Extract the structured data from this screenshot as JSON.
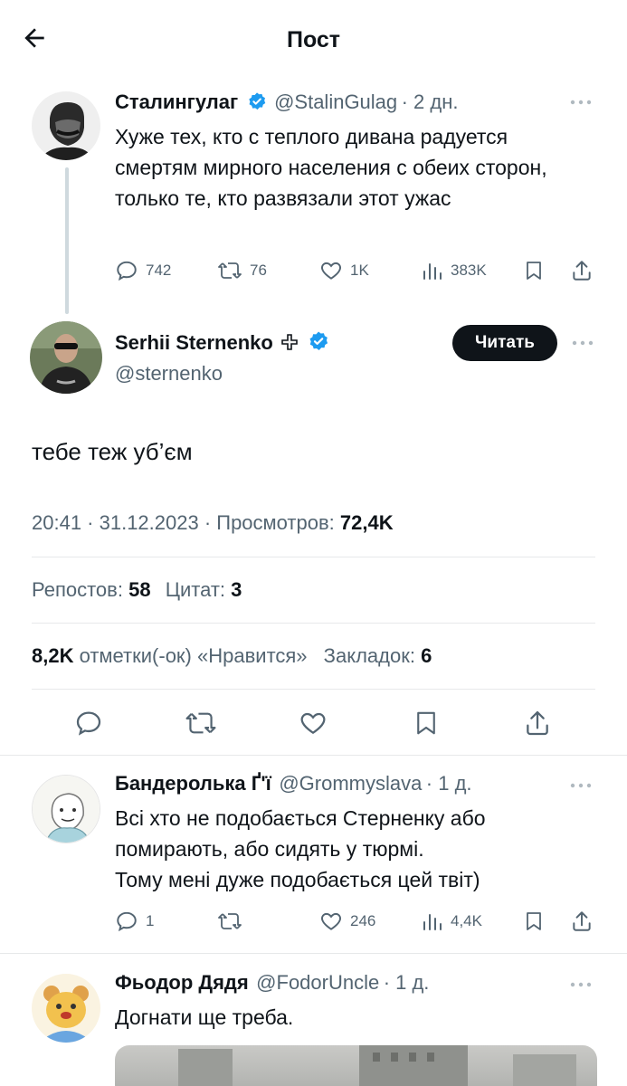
{
  "header": {
    "title": "Пост"
  },
  "parent": {
    "name": "Сталингулаг",
    "handle": "@StalinGulag",
    "time": "· 2 дн.",
    "text": "Хуже тех, кто с теплого дивана радуется смертям мирного населения с обеих сторон, только те, кто развязали этот ужас",
    "actions": {
      "replies": "742",
      "reposts": "76",
      "likes": "1K",
      "views": "383K"
    }
  },
  "main": {
    "name": "Serhii Sternenko",
    "handle": "@sternenko",
    "follow_label": "Читать",
    "text": "тебе теж уб’єм",
    "meta": {
      "time": "20:41 · 31.12.2023 · Просмотров: ",
      "views": "72,4K"
    },
    "stats": {
      "reposts_label": "Репостов: ",
      "reposts": "58",
      "quotes_label": "Цитат: ",
      "quotes": "3",
      "likes": "8,2K",
      "likes_label": " отметки(-ок) «Нравится»",
      "bookmarks_label": "Закладок: ",
      "bookmarks": "6"
    }
  },
  "replies": [
    {
      "name": "Бандеролька Ґ'ї",
      "handle": "@Grommyslava",
      "time": "· 1 д.",
      "text_lines": [
        "Всі хто не подобається Стерненку або",
        "помирають, або сидять у тюрмі.",
        "Тому мені дуже подобається цей твіт)"
      ],
      "actions": {
        "replies": "1",
        "reposts": "",
        "likes": "246",
        "views": "4,4K"
      }
    },
    {
      "name": "Фьодор Дядя",
      "handle": "@FodorUncle",
      "time": "· 1 д.",
      "text": "Догнати ще треба."
    }
  ],
  "colors": {
    "accent": "#1d9bf0",
    "text": "#0f1419",
    "muted": "#536471",
    "divider": "#e7e9ea"
  }
}
